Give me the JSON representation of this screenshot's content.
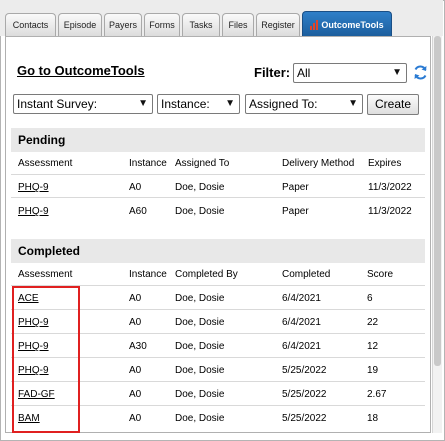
{
  "tabs": [
    "Contacts",
    "Episode",
    "Payers",
    "Forms",
    "Tasks",
    "Files",
    "Register",
    "OutcomeTools"
  ],
  "goto_link": "Go to OutcomeTools",
  "filter": {
    "label": "Filter:",
    "value": "All"
  },
  "controls": {
    "survey": "Instant Survey:",
    "instance": "Instance:",
    "assigned": "Assigned To:",
    "create": "Create"
  },
  "pending": {
    "title": "Pending",
    "headers": [
      "Assessment",
      "Instance",
      "Assigned To",
      "Delivery Method",
      "Expires"
    ],
    "rows": [
      [
        "PHQ-9",
        "A0",
        "Doe, Dosie",
        "Paper",
        "11/3/2022"
      ],
      [
        "PHQ-9",
        "A60",
        "Doe, Dosie",
        "Paper",
        "11/3/2022"
      ]
    ]
  },
  "completed": {
    "title": "Completed",
    "headers": [
      "Assessment",
      "Instance",
      "Completed By",
      "Completed",
      "Score"
    ],
    "rows": [
      [
        "ACE",
        "A0",
        "Doe, Dosie",
        "6/4/2021",
        "6"
      ],
      [
        "PHQ-9",
        "A0",
        "Doe, Dosie",
        "6/4/2021",
        "22"
      ],
      [
        "PHQ-9",
        "A30",
        "Doe, Dosie",
        "6/4/2021",
        "12"
      ],
      [
        "PHQ-9",
        "A0",
        "Doe, Dosie",
        "5/25/2022",
        "19"
      ],
      [
        "FAD-GF",
        "A0",
        "Doe, Dosie",
        "5/25/2022",
        "2.67"
      ],
      [
        "BAM",
        "A0",
        "Doe, Dosie",
        "5/25/2022",
        "18"
      ]
    ]
  },
  "colors": {
    "active_tab": "#1b5d9c",
    "highlight": "#e02020",
    "section_bg": "#e8e8e8"
  }
}
